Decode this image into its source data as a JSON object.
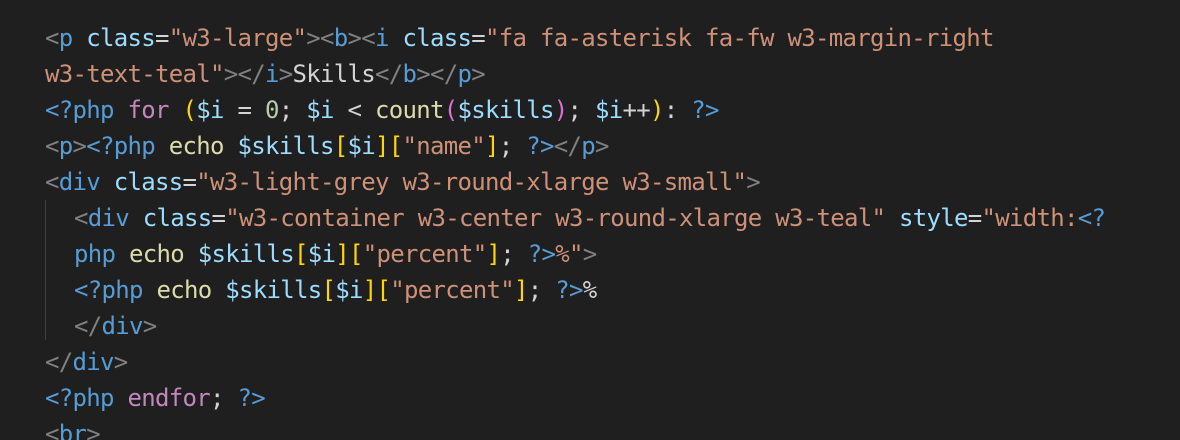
{
  "editor": {
    "lines": [
      {
        "indent": 0,
        "tokens": [
          {
            "t": "<",
            "c": "tag"
          },
          {
            "t": "p",
            "c": "name"
          },
          {
            "t": " ",
            "c": "text"
          },
          {
            "t": "class",
            "c": "attr"
          },
          {
            "t": "=",
            "c": "text"
          },
          {
            "t": "\"w3-large\"",
            "c": "str"
          },
          {
            "t": "><",
            "c": "tag"
          },
          {
            "t": "b",
            "c": "name"
          },
          {
            "t": "><",
            "c": "tag"
          },
          {
            "t": "i",
            "c": "name"
          },
          {
            "t": " ",
            "c": "text"
          },
          {
            "t": "class",
            "c": "attr"
          },
          {
            "t": "=",
            "c": "text"
          },
          {
            "t": "\"fa fa-asterisk fa-fw w3-margin-right",
            "c": "str"
          }
        ]
      },
      {
        "indent": 0,
        "tokens": [
          {
            "t": "w3-text-teal\"",
            "c": "str"
          },
          {
            "t": "></",
            "c": "tag"
          },
          {
            "t": "i",
            "c": "name"
          },
          {
            "t": ">",
            "c": "tag"
          },
          {
            "t": "Skills",
            "c": "text"
          },
          {
            "t": "</",
            "c": "tag"
          },
          {
            "t": "b",
            "c": "name"
          },
          {
            "t": "></",
            "c": "tag"
          },
          {
            "t": "p",
            "c": "name"
          },
          {
            "t": ">",
            "c": "tag"
          }
        ]
      },
      {
        "indent": 0,
        "tokens": [
          {
            "t": "<?php",
            "c": "php"
          },
          {
            "t": " ",
            "c": "text"
          },
          {
            "t": "for",
            "c": "kw"
          },
          {
            "t": " ",
            "c": "text"
          },
          {
            "t": "(",
            "c": "br1"
          },
          {
            "t": "$i",
            "c": "var"
          },
          {
            "t": " = ",
            "c": "text"
          },
          {
            "t": "0",
            "c": "num"
          },
          {
            "t": "; ",
            "c": "text"
          },
          {
            "t": "$i",
            "c": "var"
          },
          {
            "t": " < ",
            "c": "text"
          },
          {
            "t": "count",
            "c": "fn"
          },
          {
            "t": "(",
            "c": "br2"
          },
          {
            "t": "$skills",
            "c": "var"
          },
          {
            "t": ")",
            "c": "br2"
          },
          {
            "t": "; ",
            "c": "text"
          },
          {
            "t": "$i",
            "c": "var"
          },
          {
            "t": "++",
            "c": "text"
          },
          {
            "t": ")",
            "c": "br1"
          },
          {
            "t": ": ",
            "c": "text"
          },
          {
            "t": "?>",
            "c": "php"
          }
        ]
      },
      {
        "indent": 0,
        "tokens": [
          {
            "t": "<",
            "c": "tag"
          },
          {
            "t": "p",
            "c": "name"
          },
          {
            "t": ">",
            "c": "tag"
          },
          {
            "t": "<?php",
            "c": "php"
          },
          {
            "t": " ",
            "c": "text"
          },
          {
            "t": "echo",
            "c": "fn"
          },
          {
            "t": " ",
            "c": "text"
          },
          {
            "t": "$skills",
            "c": "var"
          },
          {
            "t": "[",
            "c": "br1"
          },
          {
            "t": "$i",
            "c": "var"
          },
          {
            "t": "]",
            "c": "br1"
          },
          {
            "t": "[",
            "c": "br1"
          },
          {
            "t": "\"name\"",
            "c": "str"
          },
          {
            "t": "]",
            "c": "br1"
          },
          {
            "t": "; ",
            "c": "text"
          },
          {
            "t": "?>",
            "c": "php"
          },
          {
            "t": "</",
            "c": "tag"
          },
          {
            "t": "p",
            "c": "name"
          },
          {
            "t": ">",
            "c": "tag"
          }
        ]
      },
      {
        "indent": 0,
        "tokens": [
          {
            "t": "<",
            "c": "tag"
          },
          {
            "t": "div",
            "c": "name"
          },
          {
            "t": " ",
            "c": "text"
          },
          {
            "t": "class",
            "c": "attr"
          },
          {
            "t": "=",
            "c": "text"
          },
          {
            "t": "\"w3-light-grey w3-round-xlarge w3-small\"",
            "c": "str"
          },
          {
            "t": ">",
            "c": "tag"
          }
        ]
      },
      {
        "indent": 1,
        "tokens": [
          {
            "t": "<",
            "c": "tag"
          },
          {
            "t": "div",
            "c": "name"
          },
          {
            "t": " ",
            "c": "text"
          },
          {
            "t": "class",
            "c": "attr"
          },
          {
            "t": "=",
            "c": "text"
          },
          {
            "t": "\"w3-container w3-center w3-round-xlarge w3-teal\"",
            "c": "str"
          },
          {
            "t": " ",
            "c": "text"
          },
          {
            "t": "style",
            "c": "attr"
          },
          {
            "t": "=",
            "c": "text"
          },
          {
            "t": "\"width:",
            "c": "str"
          },
          {
            "t": "<?",
            "c": "php"
          }
        ]
      },
      {
        "indent": 1,
        "tokens": [
          {
            "t": "php",
            "c": "php"
          },
          {
            "t": " ",
            "c": "text"
          },
          {
            "t": "echo",
            "c": "fn"
          },
          {
            "t": " ",
            "c": "text"
          },
          {
            "t": "$skills",
            "c": "var"
          },
          {
            "t": "[",
            "c": "br1"
          },
          {
            "t": "$i",
            "c": "var"
          },
          {
            "t": "]",
            "c": "br1"
          },
          {
            "t": "[",
            "c": "br1"
          },
          {
            "t": "\"percent\"",
            "c": "str"
          },
          {
            "t": "]",
            "c": "br1"
          },
          {
            "t": "; ",
            "c": "text"
          },
          {
            "t": "?>",
            "c": "php"
          },
          {
            "t": "%\"",
            "c": "str"
          },
          {
            "t": ">",
            "c": "tag"
          }
        ]
      },
      {
        "indent": 1,
        "tokens": [
          {
            "t": "<?php",
            "c": "php"
          },
          {
            "t": " ",
            "c": "text"
          },
          {
            "t": "echo",
            "c": "fn"
          },
          {
            "t": " ",
            "c": "text"
          },
          {
            "t": "$skills",
            "c": "var"
          },
          {
            "t": "[",
            "c": "br1"
          },
          {
            "t": "$i",
            "c": "var"
          },
          {
            "t": "]",
            "c": "br1"
          },
          {
            "t": "[",
            "c": "br1"
          },
          {
            "t": "\"percent\"",
            "c": "str"
          },
          {
            "t": "]",
            "c": "br1"
          },
          {
            "t": "; ",
            "c": "text"
          },
          {
            "t": "?>",
            "c": "php"
          },
          {
            "t": "%",
            "c": "text"
          }
        ]
      },
      {
        "indent": 1,
        "tokens": [
          {
            "t": "</",
            "c": "tag"
          },
          {
            "t": "div",
            "c": "name"
          },
          {
            "t": ">",
            "c": "tag"
          }
        ]
      },
      {
        "indent": 0,
        "tokens": [
          {
            "t": "</",
            "c": "tag"
          },
          {
            "t": "div",
            "c": "name"
          },
          {
            "t": ">",
            "c": "tag"
          }
        ]
      },
      {
        "indent": 0,
        "tokens": [
          {
            "t": "<?php",
            "c": "php"
          },
          {
            "t": " ",
            "c": "text"
          },
          {
            "t": "endfor",
            "c": "kw"
          },
          {
            "t": "; ",
            "c": "text"
          },
          {
            "t": "?>",
            "c": "php"
          }
        ]
      },
      {
        "indent": 0,
        "tokens": [
          {
            "t": "<",
            "c": "tag"
          },
          {
            "t": "br",
            "c": "name"
          },
          {
            "t": ">",
            "c": "tag"
          }
        ]
      }
    ]
  }
}
